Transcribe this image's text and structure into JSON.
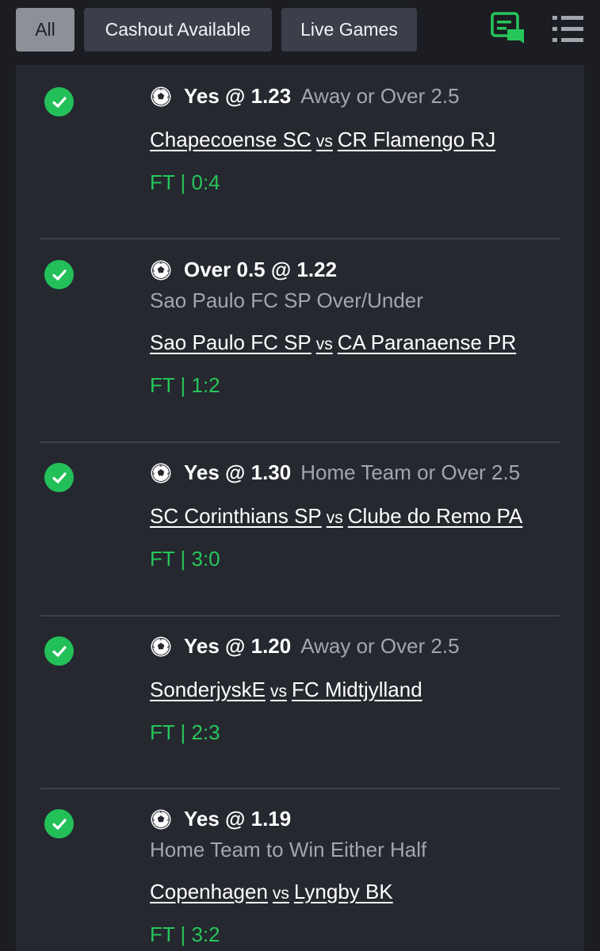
{
  "filters": {
    "all": "All",
    "cashout": "Cashout Available",
    "live": "Live Games"
  },
  "colors": {
    "accent_green": "#27c65a",
    "check_green": "#23c05a",
    "background": "#1b1d22",
    "panel": "#25282f",
    "tab_active": "#8d9097",
    "tab": "#3a3f4a"
  },
  "icons": {
    "chat": "bet-slip-chat-icon",
    "list": "list-menu-icon",
    "status": "check-circle-icon",
    "sport": "soccer-ball-icon"
  },
  "bets": [
    {
      "pick": "Yes @ 1.23",
      "market": "Away or Over 2.5",
      "home": "Chapecoense SC",
      "vs": "vs",
      "away": "CR Flamengo RJ",
      "score": "FT | 0:4",
      "status": "won"
    },
    {
      "pick": "Over 0.5 @ 1.22",
      "market": "Sao Paulo FC SP Over/Under",
      "home": "Sao Paulo FC SP",
      "vs": "vs",
      "away": "CA Paranaense PR",
      "score": "FT | 1:2",
      "status": "won"
    },
    {
      "pick": "Yes @ 1.30",
      "market": "Home Team or Over 2.5",
      "home": "SC Corinthians SP",
      "vs": "vs",
      "away": "Clube do Remo PA",
      "score": "FT | 3:0",
      "status": "won"
    },
    {
      "pick": "Yes @ 1.20",
      "market": "Away or Over 2.5",
      "home": "SonderjyskE",
      "vs": "vs",
      "away": "FC Midtjylland",
      "score": "FT | 2:3",
      "status": "won"
    },
    {
      "pick": "Yes @ 1.19",
      "market": "Home Team to Win Either Half",
      "home": "Copenhagen",
      "vs": "vs",
      "away": "Lyngby BK",
      "score": "FT | 3:2",
      "status": "won"
    }
  ]
}
